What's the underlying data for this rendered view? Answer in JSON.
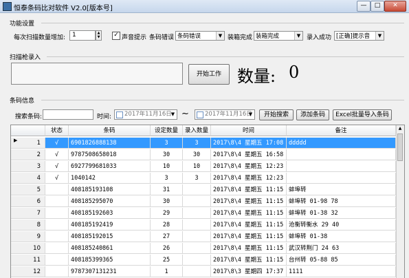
{
  "window": {
    "title": "恒泰条码比对软件 V2.0[版本号]",
    "min_label": "—",
    "max_label": "□",
    "close_label": "✕"
  },
  "settings": {
    "group_title": "功能设置",
    "increment_label": "每次扫描数量增加:",
    "increment_value": "1",
    "sound_checkbox_checked": true,
    "sound_label": "声音提示",
    "error_label": "条码错误",
    "error_value": "条码错误",
    "boxfull_label": "装箱完成",
    "boxfull_value": "装箱完成",
    "success_label": "录入成功",
    "success_value": "[正确]提示音"
  },
  "scan": {
    "group_title": "扫描枪录入",
    "start_button": "开始工作",
    "count_label": "数量:",
    "count_value": "0"
  },
  "barcode": {
    "group_title": "条码信息",
    "search_label": "搜索条码:",
    "search_value": "",
    "time_label": "时间:",
    "date_from": "2017年11月16日",
    "tilde": "~",
    "date_to": "2017年11月16日",
    "search_button": "开始搜索",
    "add_button": "添加条码",
    "import_button": "Excel批量导入条码"
  },
  "table": {
    "columns": [
      "状态",
      "条码",
      "设定数量",
      "录入数量",
      "时间",
      "备注"
    ],
    "rows": [
      {
        "no": "1",
        "status": "√",
        "code": "6901826888138",
        "set": "3",
        "entered": "3",
        "time": "2017\\8\\4 星期五 17:08",
        "note": "ddddd"
      },
      {
        "no": "2",
        "status": "√",
        "code": "9787508658018",
        "set": "30",
        "entered": "30",
        "time": "2017\\8\\4 星期五 16:58",
        "note": ""
      },
      {
        "no": "3",
        "status": "√",
        "code": "6927799681033",
        "set": "10",
        "entered": "10",
        "time": "2017\\8\\4 星期五 12:23",
        "note": ""
      },
      {
        "no": "4",
        "status": "√",
        "code": "1040142",
        "set": "3",
        "entered": "3",
        "time": "2017\\8\\4 星期五 12:23",
        "note": ""
      },
      {
        "no": "5",
        "status": "",
        "code": "408185193108",
        "set": "31",
        "entered": "",
        "time": "2017\\8\\4 星期五 11:15",
        "note": "蚌埠转"
      },
      {
        "no": "6",
        "status": "",
        "code": "408185295070",
        "set": "30",
        "entered": "",
        "time": "2017\\8\\4 星期五 11:15",
        "note": "蚌埠转 01-98 78"
      },
      {
        "no": "7",
        "status": "",
        "code": "408185192603",
        "set": "29",
        "entered": "",
        "time": "2017\\8\\4 星期五 11:15",
        "note": "蚌埠转 01-38 32"
      },
      {
        "no": "8",
        "status": "",
        "code": "408185192419",
        "set": "28",
        "entered": "",
        "time": "2017\\8\\4 星期五 11:15",
        "note": "沧衡转衡水 29 40"
      },
      {
        "no": "9",
        "status": "",
        "code": "408185192015",
        "set": "27",
        "entered": "",
        "time": "2017\\8\\4 星期五 11:15",
        "note": "蚌埠转 01-38"
      },
      {
        "no": "10",
        "status": "",
        "code": "408185240861",
        "set": "26",
        "entered": "",
        "time": "2017\\8\\4 星期五 11:15",
        "note": "武汉转荆门 24 63"
      },
      {
        "no": "11",
        "status": "",
        "code": "408185399365",
        "set": "25",
        "entered": "",
        "time": "2017\\8\\4 星期五 11:15",
        "note": "台州转 05-88 85"
      },
      {
        "no": "12",
        "status": "",
        "code": "9787307131231",
        "set": "1",
        "entered": "",
        "time": "2017\\8\\3 星期四 17:37",
        "note": "1111"
      }
    ]
  },
  "colors": {
    "selection": "#3399ff"
  }
}
